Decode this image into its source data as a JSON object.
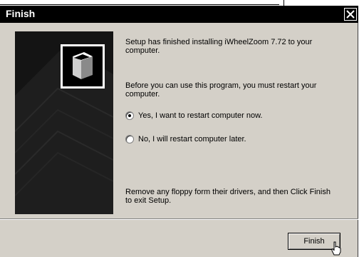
{
  "window": {
    "title": "Finish"
  },
  "messages": {
    "installed": "Setup has finished installing iWheelZoom 7.72 to your computer.",
    "restart_prompt": "Before you can use this program, you must restart your computer.",
    "floppy_notice": "Remove any floppy form their drivers, and then Click Finish to exit Setup."
  },
  "options": [
    {
      "label": "Yes, I want to restart computer now.",
      "selected": true
    },
    {
      "label": "No, I will restart computer later.",
      "selected": false
    }
  ],
  "buttons": {
    "finish": "Finish"
  },
  "icons": {
    "close": "close-icon",
    "logo": "setup-box-icon",
    "cursor": "hand-pointer-icon"
  },
  "colors": {
    "titlebar": "#000000",
    "dialog_bg": "#d4d0c8",
    "panel_bg": "#1a1a1a"
  }
}
